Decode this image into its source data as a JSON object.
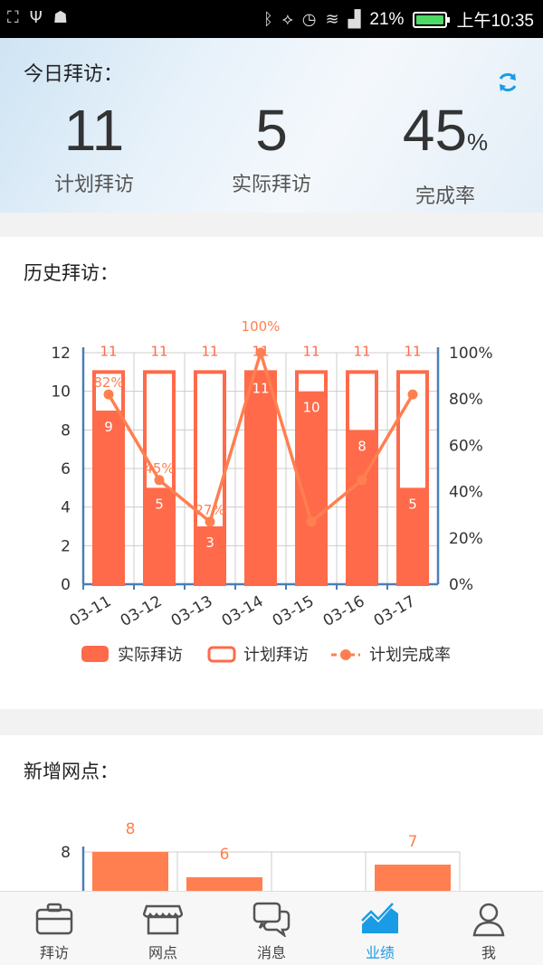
{
  "status": {
    "battery": "21%",
    "time": "上午10:35"
  },
  "today": {
    "title": "今日拜访：",
    "stats": [
      {
        "value": "11",
        "unit": "",
        "label": "计划拜访"
      },
      {
        "value": "5",
        "unit": "",
        "label": "实际拜访"
      },
      {
        "value": "45",
        "unit": "%",
        "label": "完成率"
      }
    ]
  },
  "history": {
    "title": "历史拜访："
  },
  "chart_data": [
    {
      "type": "bar",
      "title": "",
      "categories": [
        "03-11",
        "03-12",
        "03-13",
        "03-14",
        "03-15",
        "03-16",
        "03-17"
      ],
      "series": [
        {
          "name": "实际拜访",
          "type": "bar",
          "values": [
            9,
            5,
            3,
            11,
            10,
            8,
            5
          ],
          "color": "#ff6a4a"
        },
        {
          "name": "计划拜访",
          "type": "bar",
          "values": [
            11,
            11,
            11,
            11,
            11,
            11,
            11
          ],
          "color": "#ff6a4a"
        },
        {
          "name": "计划完成率",
          "type": "line",
          "values": [
            82,
            45,
            27,
            100,
            27,
            45,
            82
          ],
          "color": "#ff7f50"
        }
      ],
      "point_labels": [
        "82%",
        "45%",
        "27%",
        "100%",
        "",
        "",
        ""
      ],
      "left_axis": {
        "ticks": [
          "0",
          "2",
          "4",
          "6",
          "8",
          "10",
          "12"
        ],
        "ylim": [
          0,
          12
        ]
      },
      "right_axis": {
        "ticks": [
          "0%",
          "20%",
          "40%",
          "60%",
          "80%",
          "100%"
        ],
        "ylim": [
          0,
          100
        ]
      },
      "legend": "bottom"
    },
    {
      "type": "bar",
      "categories": [
        "",
        "",
        "",
        ""
      ],
      "values": [
        8,
        6,
        null,
        7
      ],
      "value_labels": [
        "8",
        "6",
        "",
        "7"
      ],
      "ytick_visible": "8",
      "color": "#ff7f50"
    }
  ],
  "newOutlets": {
    "title": "新增网点："
  },
  "nav": [
    {
      "label": "拜访",
      "icon": "briefcase-icon"
    },
    {
      "label": "网点",
      "icon": "store-icon"
    },
    {
      "label": "消息",
      "icon": "chat-icon"
    },
    {
      "label": "业绩",
      "icon": "chart-icon",
      "active": true
    },
    {
      "label": "我",
      "icon": "user-icon"
    }
  ],
  "colors": {
    "accent": "#ff6a4a",
    "line": "#ff7f50",
    "axis": "#4a7fb5",
    "active": "#1a9be6"
  }
}
